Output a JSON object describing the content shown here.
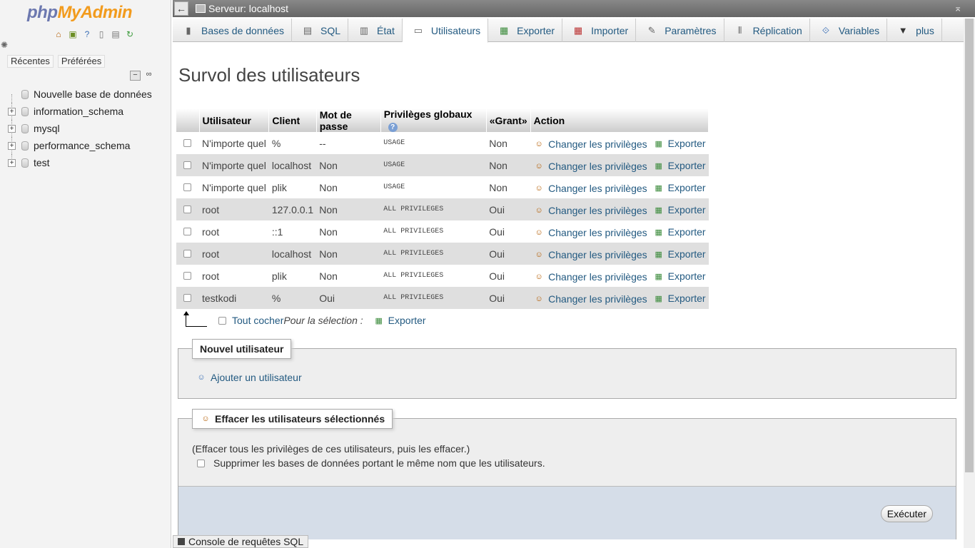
{
  "nav": {
    "logo_php": "php",
    "logo_my": "My",
    "logo_admin": "Admin",
    "tabs": [
      "Récentes",
      "Préférées"
    ],
    "tree": [
      {
        "label": "Nouvelle base de données",
        "type": "new"
      },
      {
        "label": "information_schema",
        "type": "db"
      },
      {
        "label": "mysql",
        "type": "db"
      },
      {
        "label": "performance_schema",
        "type": "db"
      },
      {
        "label": "test",
        "type": "db"
      }
    ]
  },
  "topbar": {
    "server": "Serveur: localhost"
  },
  "tabs": [
    {
      "label": "Bases de données",
      "icon": "database-icon"
    },
    {
      "label": "SQL",
      "icon": "sql-icon"
    },
    {
      "label": "État",
      "icon": "status-icon"
    },
    {
      "label": "Utilisateurs",
      "icon": "users-icon",
      "active": true
    },
    {
      "label": "Exporter",
      "icon": "export-icon"
    },
    {
      "label": "Importer",
      "icon": "import-icon"
    },
    {
      "label": "Paramètres",
      "icon": "wrench-icon"
    },
    {
      "label": "Réplication",
      "icon": "replication-icon"
    },
    {
      "label": "Variables",
      "icon": "variables-icon"
    },
    {
      "label": "plus",
      "icon": "triangle-down-icon"
    }
  ],
  "page": {
    "title": "Survol des utilisateurs"
  },
  "users_table": {
    "headers": [
      "Utilisateur",
      "Client",
      "Mot de passe",
      "Privilèges globaux",
      "«Grant»",
      "Action"
    ],
    "rows": [
      {
        "user": "N'importe quel",
        "host": "%",
        "password": "--",
        "privileges": "USAGE",
        "grant": "Non"
      },
      {
        "user": "N'importe quel",
        "host": "localhost",
        "password": "Non",
        "privileges": "USAGE",
        "grant": "Non"
      },
      {
        "user": "N'importe quel",
        "host": "plik",
        "password": "Non",
        "privileges": "USAGE",
        "grant": "Non"
      },
      {
        "user": "root",
        "host": "127.0.0.1",
        "password": "Non",
        "privileges": "ALL PRIVILEGES",
        "grant": "Oui"
      },
      {
        "user": "root",
        "host": "::1",
        "password": "Non",
        "privileges": "ALL PRIVILEGES",
        "grant": "Oui"
      },
      {
        "user": "root",
        "host": "localhost",
        "password": "Non",
        "privileges": "ALL PRIVILEGES",
        "grant": "Oui"
      },
      {
        "user": "root",
        "host": "plik",
        "password": "Non",
        "privileges": "ALL PRIVILEGES",
        "grant": "Oui"
      },
      {
        "user": "testkodi",
        "host": "%",
        "password": "Oui",
        "privileges": "ALL PRIVILEGES",
        "grant": "Oui"
      }
    ],
    "change_privileges_label": "Changer les privilèges",
    "export_label": "Exporter"
  },
  "bulk": {
    "check_all": "Tout cocher",
    "with_selected": "Pour la sélection :",
    "export": "Exporter"
  },
  "new_user": {
    "legend": "Nouvel utilisateur",
    "add_user": "Ajouter un utilisateur"
  },
  "delete_users": {
    "legend": "Effacer les utilisateurs sélectionnés",
    "description": "(Effacer tous les privilèges de ces utilisateurs, puis les effacer.)",
    "drop_db_label": "Supprimer les bases de données portant le même nom que les utilisateurs.",
    "execute": "Exécuter"
  },
  "console": {
    "label": "Console de requêtes SQL"
  }
}
